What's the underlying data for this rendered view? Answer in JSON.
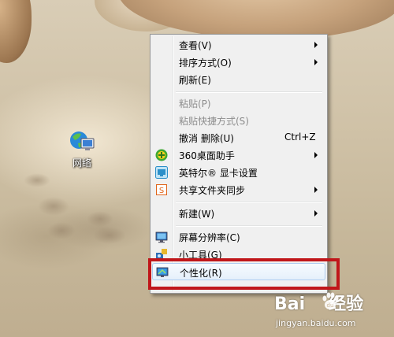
{
  "desktop": {
    "icons": [
      {
        "label": "网络",
        "icon": "network-icon"
      }
    ]
  },
  "context_menu": {
    "items": [
      {
        "label": "查看(V)",
        "submenu": true,
        "enabled": true
      },
      {
        "label": "排序方式(O)",
        "submenu": true,
        "enabled": true
      },
      {
        "label": "刷新(E)",
        "submenu": false,
        "enabled": true
      },
      {
        "label": "粘贴(P)",
        "submenu": false,
        "enabled": false
      },
      {
        "label": "粘贴快捷方式(S)",
        "submenu": false,
        "enabled": false
      },
      {
        "label": "撤消 删除(U)",
        "shortcut": "Ctrl+Z",
        "submenu": false,
        "enabled": true
      },
      {
        "label": "360桌面助手",
        "icon": "360-assistant-icon",
        "submenu": true,
        "enabled": true
      },
      {
        "label": "英特尔® 显卡设置",
        "icon": "intel-graphics-icon",
        "submenu": false,
        "enabled": true
      },
      {
        "label": "共享文件夹同步",
        "icon": "folder-sync-icon",
        "submenu": true,
        "enabled": true
      },
      {
        "label": "新建(W)",
        "submenu": true,
        "enabled": true
      },
      {
        "label": "屏幕分辨率(C)",
        "icon": "display-resolution-icon",
        "submenu": false,
        "enabled": true
      },
      {
        "label": "小工具(G)",
        "icon": "gadgets-icon",
        "submenu": false,
        "enabled": true
      },
      {
        "label": "个性化(R)",
        "icon": "personalize-icon",
        "submenu": false,
        "enabled": true,
        "highlighted": true
      }
    ]
  },
  "annotation": {
    "color": "#c0161a",
    "target": "个性化(R)"
  },
  "watermark": {
    "brand": "Bai",
    "brand_suffix": "经验",
    "url": "jingyan.baidu.com"
  }
}
